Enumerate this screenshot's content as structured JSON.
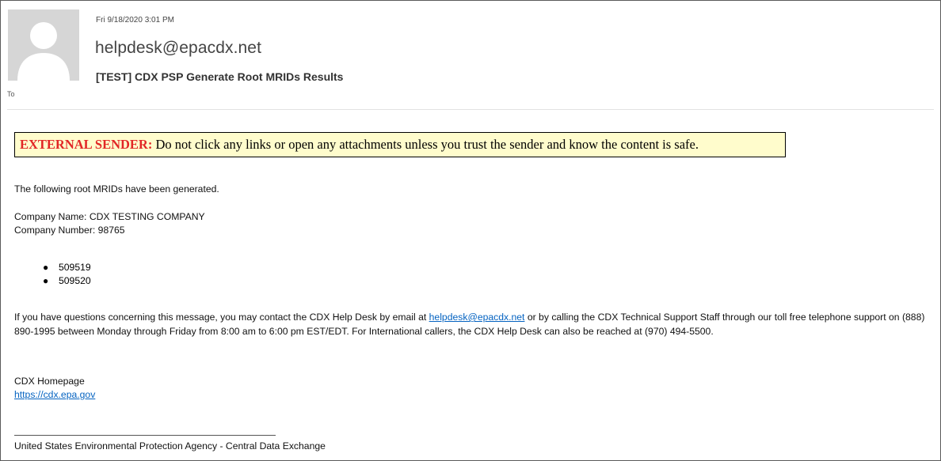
{
  "header": {
    "date": "Fri 9/18/2020 3:01 PM",
    "from": "helpdesk@epacdx.net",
    "subject": "[TEST] CDX PSP Generate Root MRIDs Results",
    "to_label": "To"
  },
  "banner": {
    "label": "EXTERNAL SENDER:",
    "text": " Do not click any links or open any attachments unless you trust the sender and know the content is safe."
  },
  "body": {
    "intro": "The following root MRIDs have been generated.",
    "company_name": "Company Name: CDX TESTING COMPANY",
    "company_number": "Company Number: 98765",
    "mrids": [
      "509519",
      "509520"
    ],
    "contact_pre": "If you have questions concerning this message, you may contact the CDX Help Desk by email at ",
    "contact_email": "helpdesk@epacdx.net",
    "contact_post": " or by calling the CDX Technical Support Staff through our toll free telephone support on (888) 890-1995 between Monday through Friday from 8:00 am to 6:00 pm EST/EDT. For International callers, the CDX Help Desk can also be reached at (970) 494-5500.",
    "homepage_label": "CDX Homepage",
    "homepage_url": "https://cdx.epa.gov",
    "footer": "United States Environmental Protection Agency - Central Data Exchange"
  },
  "icons": {
    "avatar": "person-silhouette-icon",
    "bullet": "bullet-icon"
  },
  "colors": {
    "banner_bg": "#fffccc",
    "banner_label": "#e22626",
    "link": "#0563c1"
  }
}
